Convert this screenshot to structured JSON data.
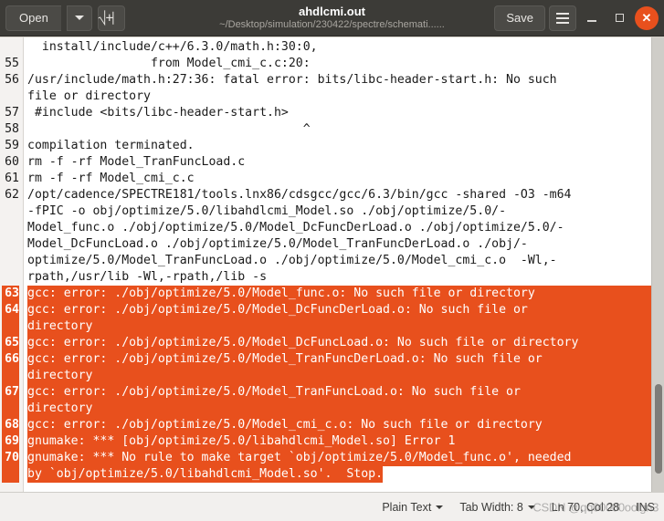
{
  "header": {
    "open_label": "Open",
    "open_dropdown_icon": "chevron-down-icon",
    "new_document_icon": "new-document-icon",
    "new_document_glyph": "⊞",
    "title": "ahdlcmi.out",
    "subtitle": "~/Desktop/simulation/230422/spectre/schemati......",
    "save_label": "Save",
    "menu_icon": "hamburger-menu-icon",
    "minimize_icon": "minimize-icon",
    "maximize_icon": "maximize-icon",
    "close_icon": "close-icon",
    "close_glyph": "✕",
    "accent_color": "#e8501d",
    "bar_color": "#3c3b37"
  },
  "editor": {
    "error_color": "#e8501d",
    "lines": [
      {
        "num": "",
        "text": "  install/include/c++/6.3.0/math.h:30:0,",
        "error": false
      },
      {
        "num": "55",
        "text": "                 from Model_cmi_c.c:20:",
        "error": false
      },
      {
        "num": "56",
        "text": "/usr/include/math.h:27:36: fatal error: bits/libc-header-start.h: No such",
        "error": false
      },
      {
        "num": "",
        "text": "file or directory",
        "error": false
      },
      {
        "num": "57",
        "text": " #include <bits/libc-header-start.h>",
        "error": false
      },
      {
        "num": "58",
        "text": "                                      ^",
        "error": false
      },
      {
        "num": "59",
        "text": "compilation terminated.",
        "error": false
      },
      {
        "num": "60",
        "text": "rm -f -rf Model_TranFuncLoad.c",
        "error": false
      },
      {
        "num": "61",
        "text": "rm -f -rf Model_cmi_c.c",
        "error": false
      },
      {
        "num": "62",
        "text": "/opt/cadence/SPECTRE181/tools.lnx86/cdsgcc/gcc/6.3/bin/gcc -shared -O3 -m64",
        "error": false
      },
      {
        "num": "",
        "text": "-fPIC -o obj/optimize/5.0/libahdlcmi_Model.so ./obj/optimize/5.0/-",
        "error": false
      },
      {
        "num": "",
        "text": "Model_func.o ./obj/optimize/5.0/Model_DcFuncDerLoad.o ./obj/optimize/5.0/-",
        "error": false
      },
      {
        "num": "",
        "text": "Model_DcFuncLoad.o ./obj/optimize/5.0/Model_TranFuncDerLoad.o ./obj/-",
        "error": false
      },
      {
        "num": "",
        "text": "optimize/5.0/Model_TranFuncLoad.o ./obj/optimize/5.0/Model_cmi_c.o  -Wl,-",
        "error": false
      },
      {
        "num": "",
        "text": "rpath,/usr/lib -Wl,-rpath,/lib -s",
        "error": false
      },
      {
        "num": "63",
        "text": "gcc: error: ./obj/optimize/5.0/Model_func.o: No such file or directory",
        "error": true
      },
      {
        "num": "64",
        "text": "gcc: error: ./obj/optimize/5.0/Model_DcFuncDerLoad.o: No such file or",
        "error": true
      },
      {
        "num": "",
        "text": "directory",
        "error": true
      },
      {
        "num": "65",
        "text": "gcc: error: ./obj/optimize/5.0/Model_DcFuncLoad.o: No such file or directory",
        "error": true
      },
      {
        "num": "66",
        "text": "gcc: error: ./obj/optimize/5.0/Model_TranFuncDerLoad.o: No such file or",
        "error": true
      },
      {
        "num": "",
        "text": "directory",
        "error": true
      },
      {
        "num": "67",
        "text": "gcc: error: ./obj/optimize/5.0/Model_TranFuncLoad.o: No such file or",
        "error": true
      },
      {
        "num": "",
        "text": "directory",
        "error": true
      },
      {
        "num": "68",
        "text": "gcc: error: ./obj/optimize/5.0/Model_cmi_c.o: No such file or directory",
        "error": true
      },
      {
        "num": "69",
        "text": "gnumake: *** [obj/optimize/5.0/libahdlcmi_Model.so] Error 1",
        "error": true
      },
      {
        "num": "70",
        "text": "gnumake: *** No rule to make target `obj/optimize/5.0/Model_func.o', needed",
        "error": true
      },
      {
        "num": "",
        "text": "by `obj/optimize/5.0/libahdlcmi_Model.so'.  Stop.",
        "error": true,
        "fit": true
      }
    ]
  },
  "statusbar": {
    "language": "Plain Text",
    "tab_width": "Tab Width: 8",
    "position": "Ln 70, Col 28",
    "insert_mode": "INS",
    "watermark": "CSDN @qq00000oolgn3"
  }
}
